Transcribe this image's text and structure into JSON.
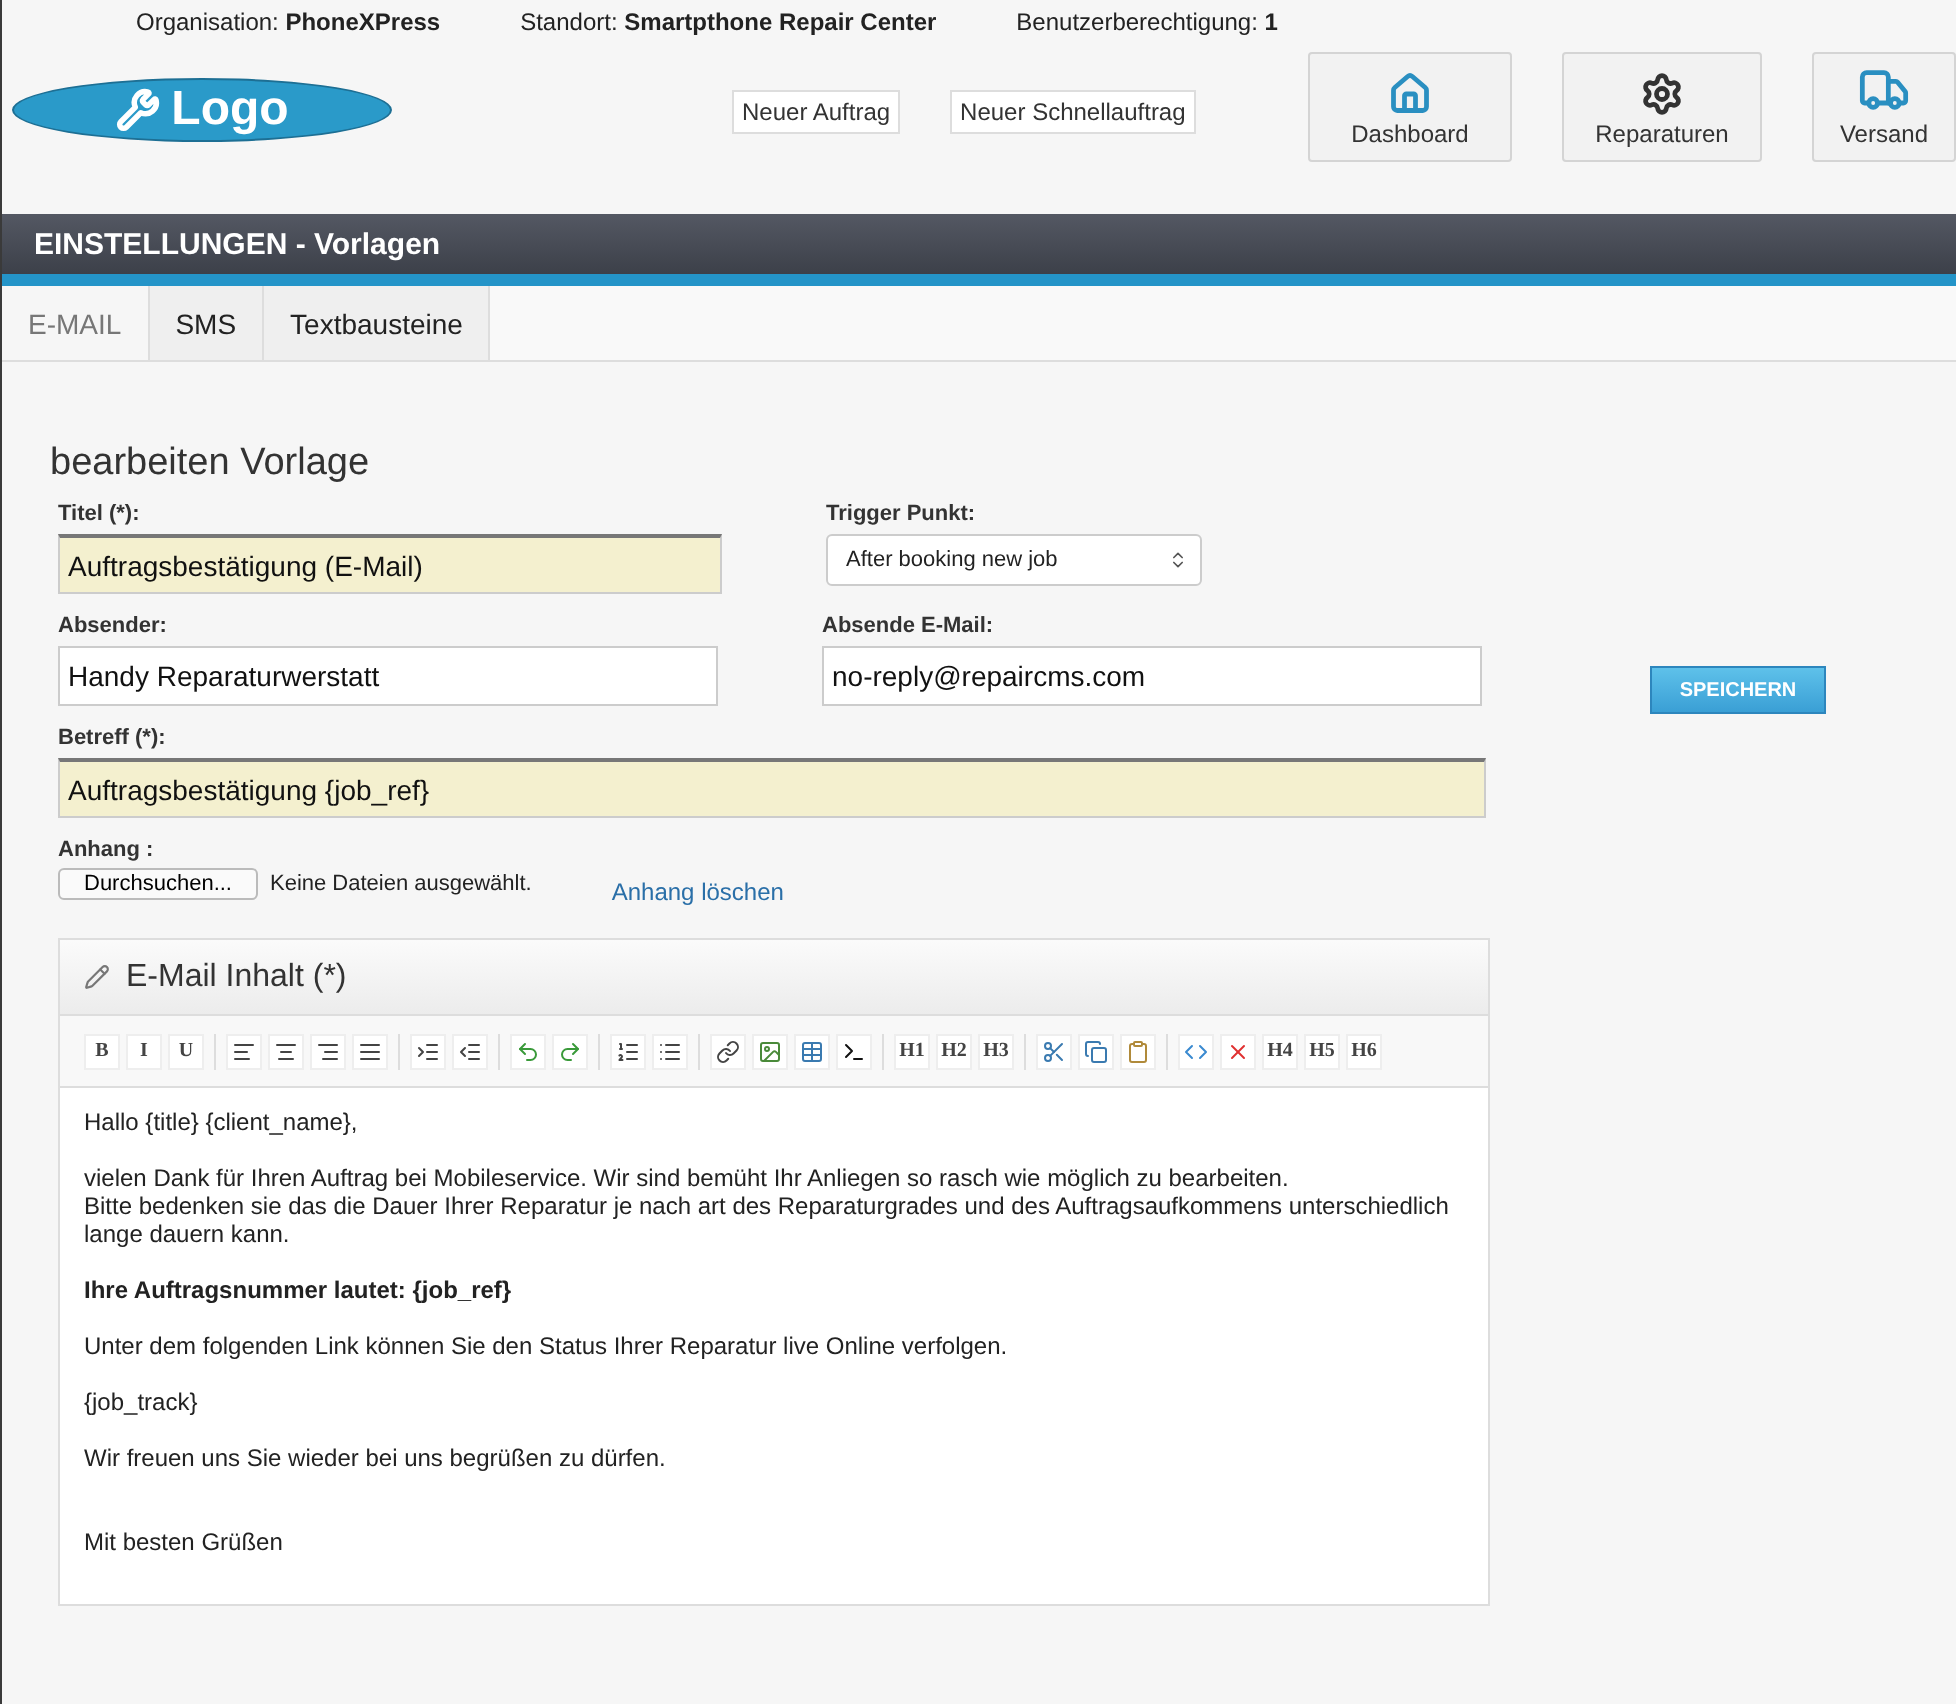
{
  "info_bar": [
    {
      "label": "Organisation:",
      "value": "PhoneXPress"
    },
    {
      "label": "Standort:",
      "value": "Smartpthone Repair Center"
    },
    {
      "label": "Benutzerberechtigung:",
      "value": "1"
    }
  ],
  "logo": {
    "text": "Logo"
  },
  "quick_buttons": [
    "Neuer Auftrag",
    "Neuer Schnellauftrag"
  ],
  "nav_buttons": [
    {
      "kind": "home",
      "label": "Dashboard"
    },
    {
      "kind": "repair",
      "label": "Reparaturen"
    },
    {
      "kind": "truck",
      "label": "Versand"
    }
  ],
  "page_title": "EINSTELLUNGEN - Vorlagen",
  "tabs": [
    {
      "label": "E-MAIL",
      "selected": true
    },
    {
      "label": "SMS",
      "selected": false
    },
    {
      "label": "Textbausteine",
      "selected": false
    }
  ],
  "form": {
    "heading": "bearbeiten Vorlage",
    "title": {
      "label": "Titel (*):",
      "value": "Auftragsbestätigung (E-Mail)",
      "required": true
    },
    "trigger": {
      "label": "Trigger Punkt:",
      "value": "After booking new job"
    },
    "sender": {
      "label": "Absender:",
      "value": "Handy Reparaturwerstatt",
      "required": false
    },
    "sender_email": {
      "label": "Absende E-Mail:",
      "value": "no-reply@repaircms.com",
      "required": false
    },
    "subject": {
      "label": "Betreff (*):",
      "value": "Auftragsbestätigung {job_ref}",
      "required": true
    },
    "attachment": {
      "label": "Anhang :",
      "button": "Durchsuchen...",
      "status": "Keine Dateien ausgewählt.",
      "delete_link": "Anhang löschen"
    }
  },
  "editor": {
    "title": "E-Mail Inhalt (*)",
    "toolbar": {
      "format": [
        "B",
        "I",
        "U"
      ],
      "headings": [
        "H1",
        "H2",
        "H3"
      ],
      "headings_more": [
        "H4",
        "H5",
        "H6"
      ]
    },
    "paragraphs": [
      {
        "bold": false,
        "lines": [
          "Hallo {title} {client_name},"
        ]
      },
      {
        "bold": false,
        "lines": [
          "vielen Dank für Ihren Auftrag bei Mobileservice. Wir sind bemüht Ihr Anliegen so rasch wie möglich zu bearbeiten.",
          "Bitte bedenken sie das die Dauer Ihrer Reparatur je nach art des Reparaturgrades und des Auftragsaufkommens unterschiedlich",
          "lange dauern kann."
        ]
      },
      {
        "bold": true,
        "lines": [
          "Ihre Auftragsnummer lautet: {job_ref}"
        ]
      },
      {
        "bold": false,
        "lines": [
          "Unter dem folgenden Link können Sie den Status Ihrer Reparatur live Online verfolgen."
        ]
      },
      {
        "bold": false,
        "lines": [
          "{job_track}"
        ]
      },
      {
        "bold": false,
        "lines": [
          "Wir freuen uns Sie wieder bei uns begrüßen zu dürfen."
        ]
      },
      {
        "bold": false,
        "lines": [
          "Mit besten Grüßen"
        ]
      }
    ]
  },
  "save_button": "SPEICHERN"
}
